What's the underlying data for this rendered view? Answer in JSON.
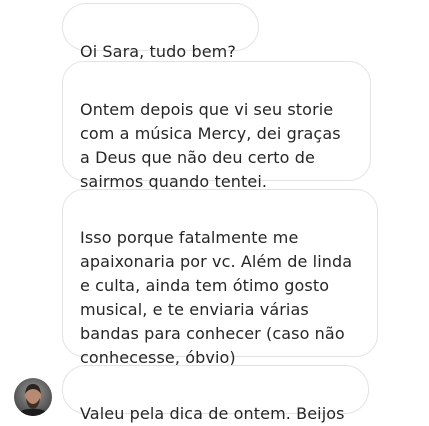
{
  "messages": [
    {
      "text": "Oi Sara, tudo bem?"
    },
    {
      "text": "Ontem depois que vi seu storie\ncom a música Mercy, dei graças\na Deus que não deu certo de\nsairmos quando tentei."
    },
    {
      "text": "Isso porque fatalmente me\napaixonaria por vc. Além de linda\ne culta, ainda tem ótimo gosto\nmusical, e te enviaria várias\nbandas para conhecer (caso não\nconhecesse, óbvio)"
    },
    {
      "text": "Valeu pela dica de ontem. Beijos"
    }
  ]
}
